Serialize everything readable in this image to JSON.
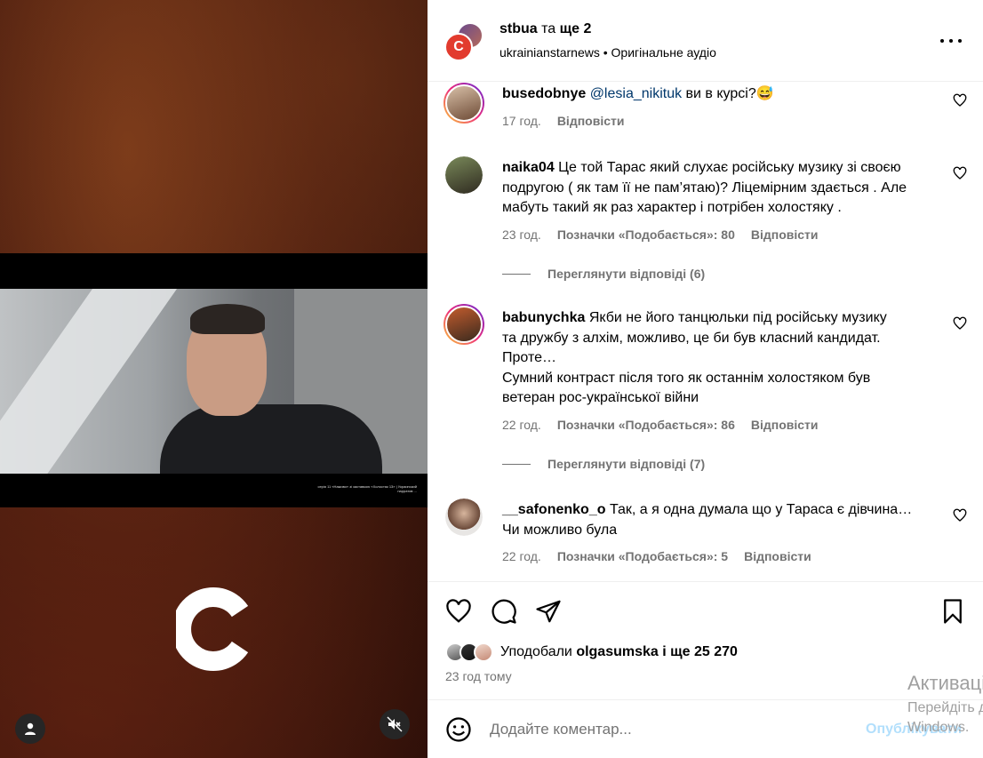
{
  "media": {
    "caption_tiny": "серія 11 «Наживо» зі заставкою «Холостяк 13» | Украинский нарратив ...",
    "brand_letter": "C"
  },
  "header": {
    "username": "stbua",
    "conjunction": "та",
    "more_users": "ще 2",
    "coauthor": "ukrainianstarnews",
    "separator": "•",
    "audio": "Оригінальне аудіо"
  },
  "comments": [
    {
      "username": "busedobnye",
      "mention": "@lesia_nikituk",
      "text": "ви в курсі?😅",
      "time": "17 год.",
      "likes": "",
      "reply": "Відповісти"
    },
    {
      "username": "naika04",
      "text": "Це той Тарас який слухає російську музику зі своєю подругою ( як там її не пам’ятаю)? Ліцемірним здається . Але мабуть такий як раз характер і потрібен холостяку .",
      "time": "23 год.",
      "likes": "Позначки «Подобається»: 80",
      "reply": "Відповісти",
      "view_replies": "Переглянути відповіді (6)"
    },
    {
      "username": "babunychka",
      "text_lines": [
        "Якби не його танцюльки під російську музику",
        "та дружбу з алхім, можливо, це би був класний кандидат.",
        "Проте…",
        "Сумний контраст після того як останнім холостяком був",
        "ветеран рос-української війни"
      ],
      "time": "22 год.",
      "likes": "Позначки «Подобається»: 86",
      "reply": "Відповісти",
      "view_replies": "Переглянути відповіді (7)"
    },
    {
      "username": "__safonenko_o",
      "text": "Так, а я одна думала що у Тараса є дівчина… Чи можливо була",
      "time": "22 год.",
      "likes": "Позначки «Подобається»: 5",
      "reply": "Відповісти"
    }
  ],
  "likes": {
    "prefix": "Уподобали",
    "user": "olgasumska",
    "suffix": "і ще 25 270"
  },
  "time_ago": "23 год тому",
  "compose": {
    "placeholder": "Додайте коментар...",
    "publish": "Опублікувати"
  },
  "watermark": {
    "line1": "Активація Windows",
    "line2": "Перейдіть до параметрів",
    "line3": "Windows."
  },
  "colors": {
    "link": "#00376b",
    "meta": "#737373",
    "publish_disabled": "#b2dffc",
    "brand_red": "#e23b2e"
  }
}
